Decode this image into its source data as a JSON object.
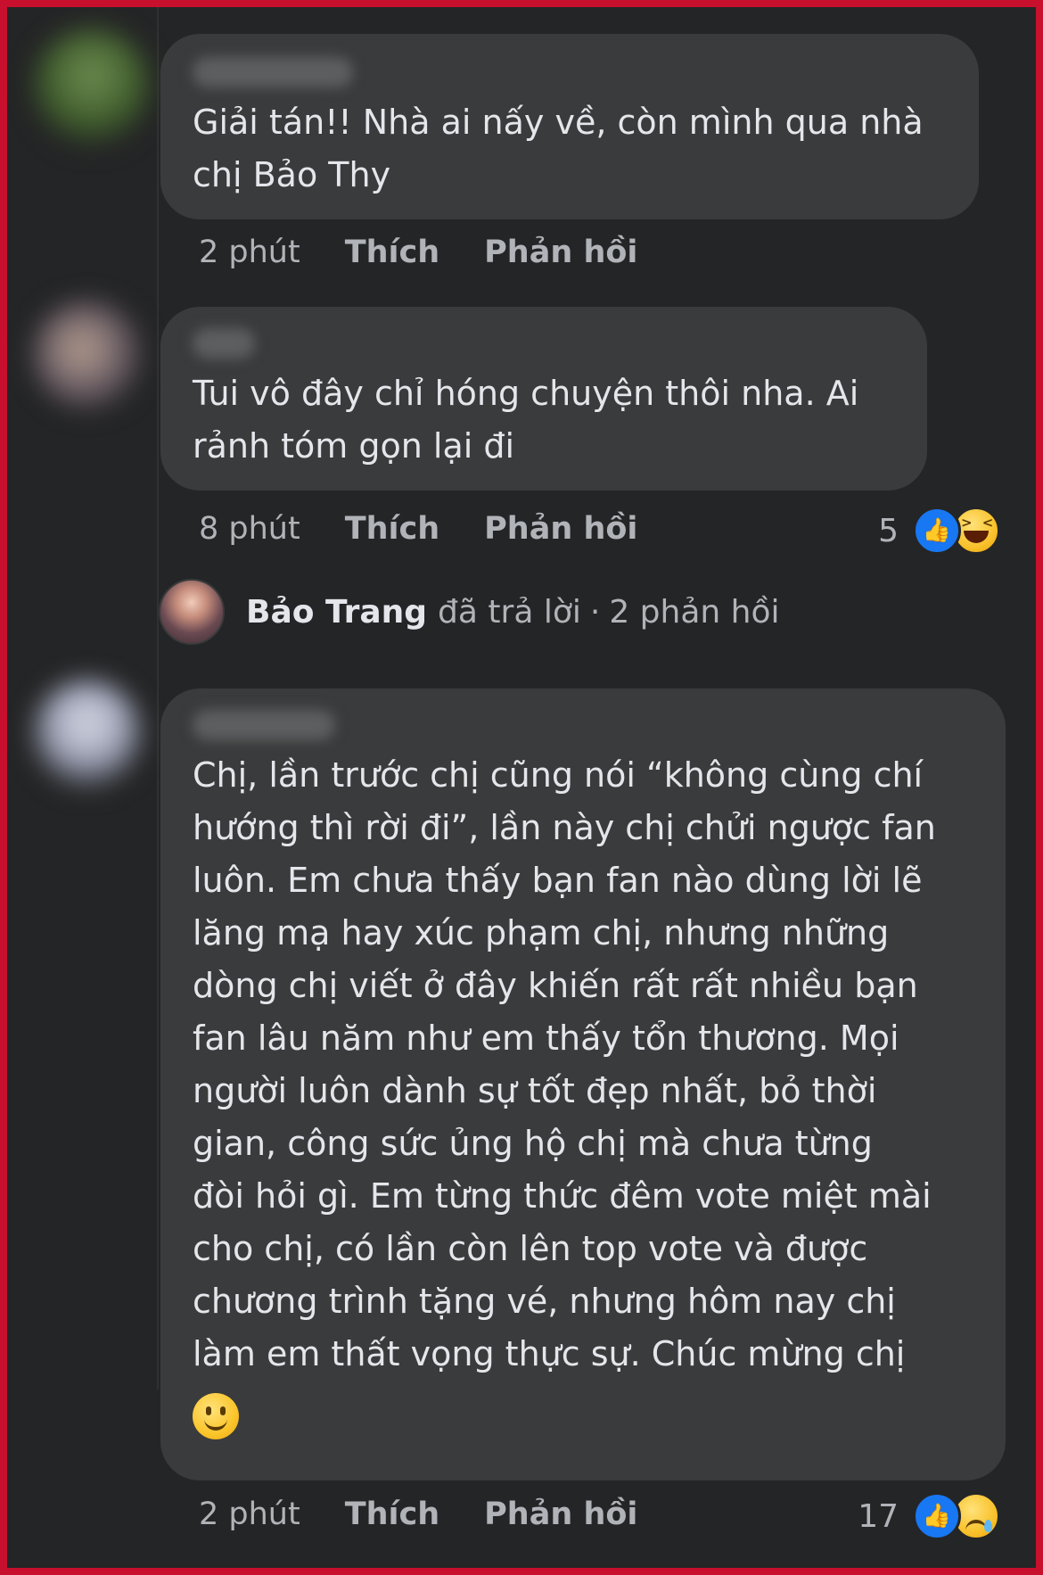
{
  "comments": [
    {
      "text_lines": [
        "Giải tán!! Nhà ai nấy về, còn mình qua nhà",
        "chị Bảo Thy"
      ],
      "time": "2 phút",
      "like_label": "Thích",
      "reply_label": "Phản hồi"
    },
    {
      "text_lines": [
        "Tui vô đây chỉ hóng chuyện thôi nha. Ai",
        "rảnh tóm gọn lại đi"
      ],
      "time": "8 phút",
      "like_label": "Thích",
      "reply_label": "Phản hồi",
      "reaction_count": "5",
      "reactions": [
        "like-icon",
        "haha-icon"
      ]
    },
    {
      "text_lines": [
        "Chị, lần trước chị cũng nói “không cùng chí",
        "hướng thì rời đi”, lần này chị chửi ngược fan",
        "luôn. Em chưa thấy bạn fan nào dùng lời lẽ",
        "lăng mạ hay xúc phạm chị, nhưng những",
        "dòng chị viết ở đây khiến rất rất nhiều bạn",
        "fan lâu năm như em thấy tổn thương. Mọi",
        "người luôn dành sự tốt đẹp nhất, bỏ thời",
        "gian, công sức ủng hộ chị mà chưa từng",
        "đòi hỏi gì. Em từng thức đêm vote miệt mài",
        "cho chị, có lần còn lên top vote và được",
        "chương trình tặng vé, nhưng hôm nay chị",
        "làm em thất vọng thực sự. Chúc mừng chị"
      ],
      "emoji": "slightly-smiling-face-icon",
      "time": "2 phút",
      "like_label": "Thích",
      "reply_label": "Phản hồi",
      "reaction_count": "17",
      "reactions": [
        "like-icon",
        "sad-icon"
      ]
    }
  ],
  "reply_summary": {
    "name": "Bảo Trang",
    "action": "đã trả lời",
    "separator": "·",
    "count_text": "2 phản hồi"
  },
  "colors": {
    "background": "#242526",
    "bubble": "#3a3b3c",
    "text": "#e4e6eb",
    "secondary_text": "#b0b3b8",
    "like_blue": "#1877f2",
    "frame_border": "#c8102e"
  }
}
